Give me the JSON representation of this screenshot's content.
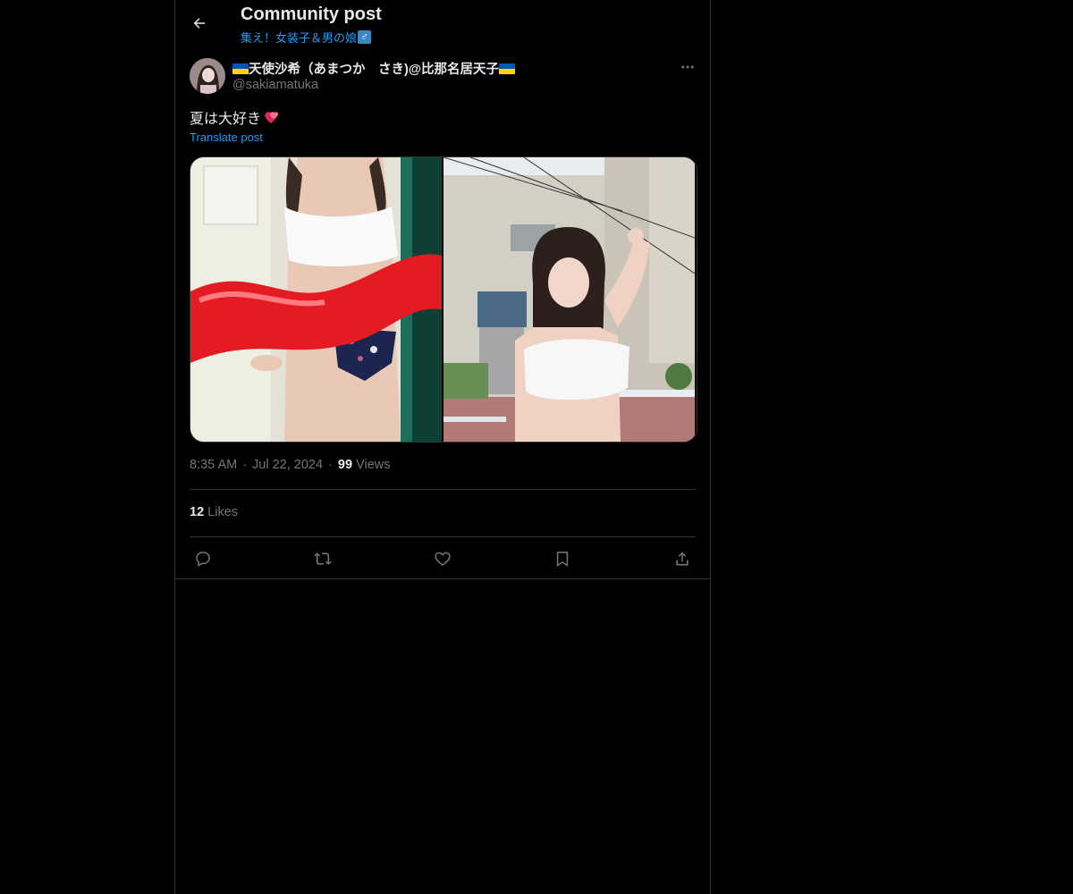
{
  "header": {
    "title": "Community post",
    "community": "集え！女装子＆男の娘",
    "community_symbol": "♂"
  },
  "post": {
    "author": {
      "name": "天使沙希（あまつか　さき)@比那名居天子",
      "handle": "@sakiamatuka"
    },
    "text": "夏は大好き",
    "text_emoji": "heart-emoji",
    "translate_label": "Translate post",
    "time": "8:35 AM",
    "date": "Jul 22, 2024",
    "views_count": "99",
    "views_label": "Views",
    "likes_count": "12",
    "likes_label": "Likes"
  },
  "colors": {
    "background": "#000000",
    "text": "#e7e9ea",
    "secondary": "#71767b",
    "accent": "#1d9bf0",
    "border": "#2f3336"
  },
  "icons": {
    "back": "arrow-left-icon",
    "more": "more-horizontal-icon",
    "reply": "reply-icon",
    "repost": "repost-icon",
    "like": "heart-icon",
    "bookmark": "bookmark-icon",
    "share": "share-icon"
  }
}
